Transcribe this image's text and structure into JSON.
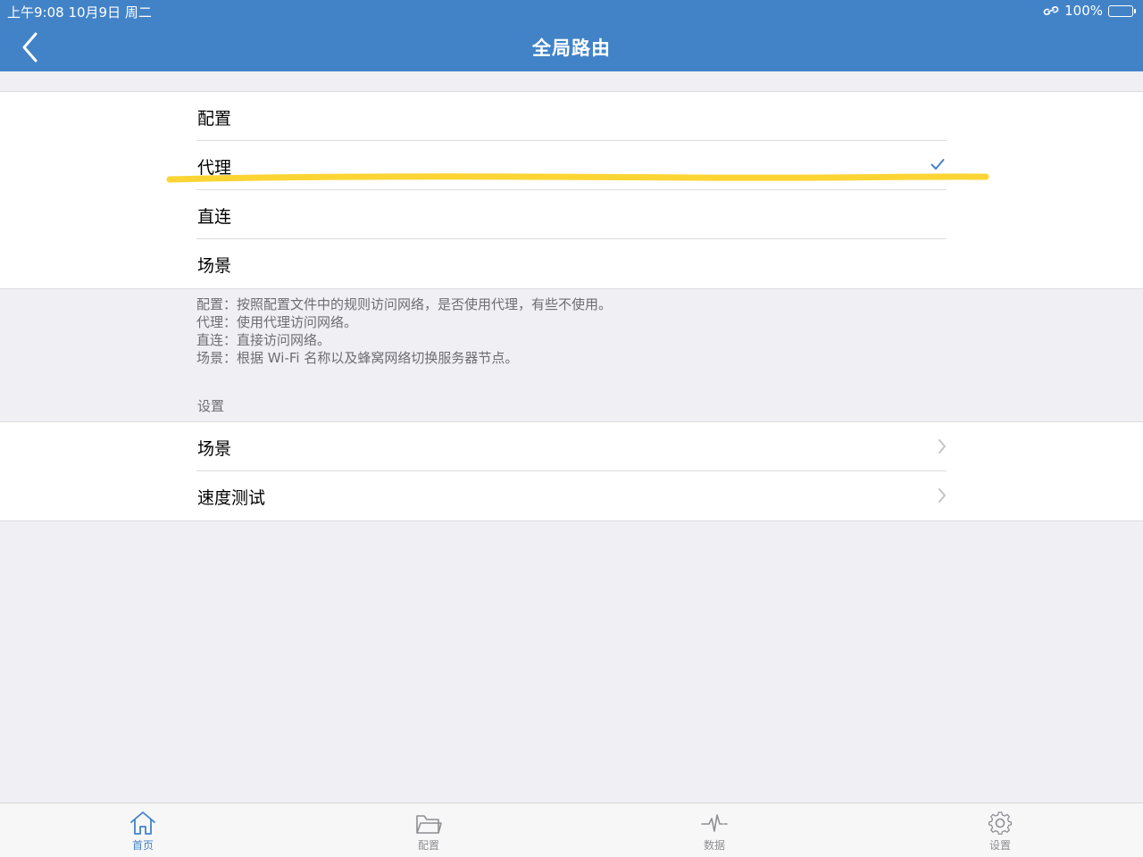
{
  "status_bar": {
    "time_date": "上午9:08   10月9日 周二",
    "battery": "100%",
    "battery_level": 1.0
  },
  "nav": {
    "title": "全局路由",
    "back_icon": "chevron-left-icon"
  },
  "mode_options": [
    {
      "label": "配置",
      "selected": false
    },
    {
      "label": "代理",
      "selected": true
    },
    {
      "label": "直连",
      "selected": false
    },
    {
      "label": "场景",
      "selected": false
    }
  ],
  "description": [
    "配置：按照配置文件中的规则访问网络，是否使用代理，有些不使用。",
    "代理：使用代理访问网络。",
    "直连：直接访问网络。",
    "场景：根据 Wi-Fi 名称以及蜂窝网络切换服务器节点。"
  ],
  "settings_section": {
    "header": "设置",
    "items": [
      {
        "label": "场景"
      },
      {
        "label": "速度测试"
      }
    ]
  },
  "tabbar": [
    {
      "label": "首页",
      "icon": "home-icon",
      "active": true
    },
    {
      "label": "配置",
      "icon": "folder-icon",
      "active": false
    },
    {
      "label": "数据",
      "icon": "pulse-icon",
      "active": false
    },
    {
      "label": "设置",
      "icon": "gear-icon",
      "active": false
    }
  ],
  "colors": {
    "nav_background": "#4283c8",
    "accent": "#4283c8",
    "page_background": "#efeff4",
    "highlight_marker": "#fcd535"
  }
}
